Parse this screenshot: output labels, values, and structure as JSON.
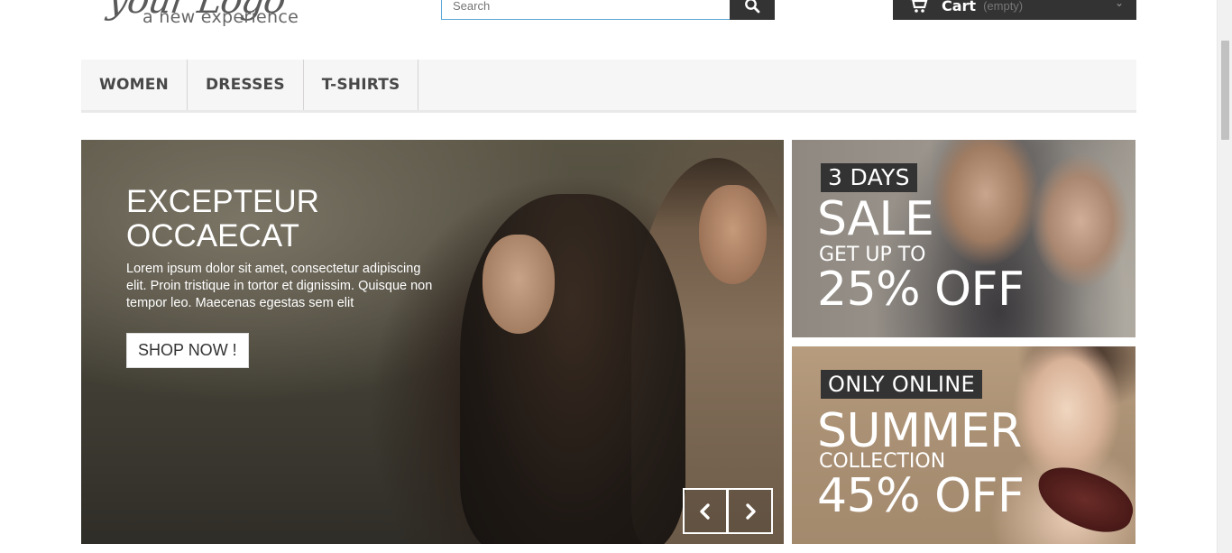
{
  "header": {
    "logo_script": "your Logo",
    "logo_tagline": "a new experience",
    "search_placeholder": "Search",
    "cart_label": "Cart",
    "cart_status": "(empty)"
  },
  "nav": {
    "items": [
      "WOMEN",
      "DRESSES",
      "T-SHIRTS"
    ]
  },
  "slider": {
    "title": "EXCEPTEUR OCCAECAT",
    "text": "Lorem ipsum dolor sit amet, consectetur adipiscing elit. Proin tristique in tortor et dignissim. Quisque non tempor leo. Maecenas egestas sem elit",
    "button": "SHOP NOW !"
  },
  "banners": [
    {
      "tag": "3 DAYS",
      "big": "SALE",
      "small": "GET UP TO",
      "pct": "25% OFF"
    },
    {
      "tag": "ONLY ONLINE",
      "big": "SUMMER",
      "small": "COLLECTION",
      "pct": "45% OFF"
    }
  ],
  "icons": {
    "search": "search-icon",
    "cart": "cart-icon",
    "prev": "chevron-left-icon",
    "next": "chevron-right-icon"
  },
  "colors": {
    "dark": "#333333",
    "nav_bg": "#f6f6f6",
    "search_border": "#5aa6d6"
  }
}
